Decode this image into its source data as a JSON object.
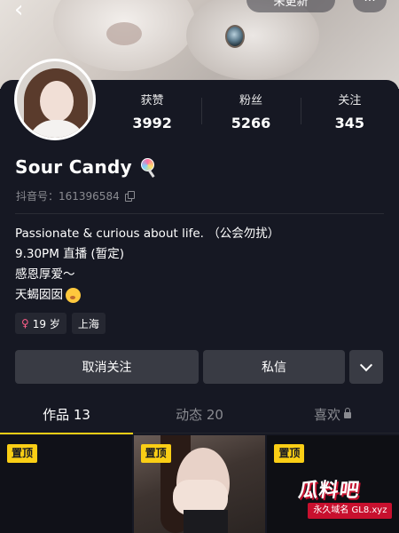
{
  "header": {
    "back_label": "‹",
    "update_pill": "未更新",
    "more_label": "···"
  },
  "profile": {
    "name": "Sour Candy",
    "douyin_id": "抖音号：161396584",
    "stats": [
      {
        "label": "获赞",
        "value": "3992"
      },
      {
        "label": "粉丝",
        "value": "5266"
      },
      {
        "label": "关注",
        "value": "345"
      }
    ],
    "bio_lines": [
      "Passionate & curious about life. （公会勿扰）",
      "9.30PM 直播 (暂定)",
      "感恩厚爱～",
      "天蝎囡囡"
    ],
    "tags": [
      {
        "icon": "female-icon",
        "label": "19 岁"
      },
      {
        "label": "上海"
      }
    ]
  },
  "actions": {
    "unfollow_label": "取消关注",
    "message_label": "私信"
  },
  "tabs": [
    {
      "label": "作品 13",
      "active": true
    },
    {
      "label": "动态 20",
      "active": false
    },
    {
      "label": "喜欢",
      "active": false,
      "locked": true
    }
  ],
  "grid": {
    "pin_label": "置顶",
    "watermark_logo": "瓜料吧",
    "watermark_site": "永久域名 GL8.xyz"
  },
  "colors": {
    "background": "#161823",
    "accent": "#face15",
    "button": "#393b44",
    "muted_text": "#8a8b91"
  }
}
